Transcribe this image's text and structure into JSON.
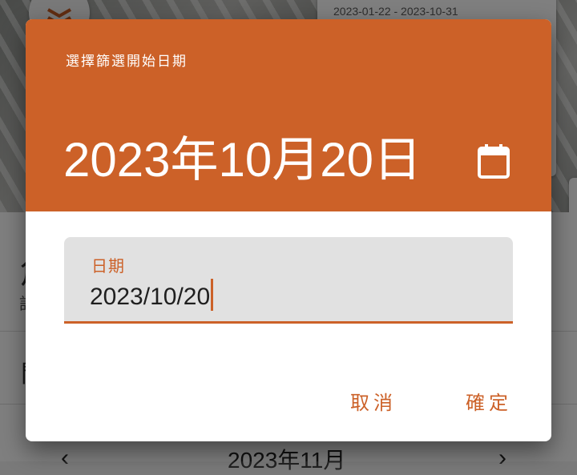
{
  "background": {
    "date_range": "2023-01-22 - 2023-10-31",
    "row1_glyph": "角",
    "row1_sub": "記",
    "row2_glyph": "間",
    "calendar_month": "2023年11月",
    "prev_symbol": "‹",
    "next_symbol": "›"
  },
  "dialog": {
    "title": "選擇篩選開始日期",
    "selected_date": "2023年10月20日",
    "mode_toggle_icon": "calendar-icon",
    "input": {
      "label": "日期",
      "value": "2023/10/20"
    },
    "cancel_label": "取消",
    "ok_label": "確定"
  },
  "colors": {
    "accent": "#cc6128",
    "field_bg": "#e1e1e1",
    "surface": "#ffffff"
  }
}
